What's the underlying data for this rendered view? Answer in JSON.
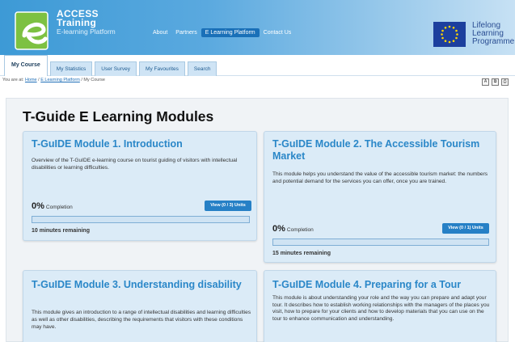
{
  "brand": {
    "line1": "ACCESS",
    "line2": "Training",
    "line3": "E-learning Platform"
  },
  "top_nav": [
    "About",
    "Partners",
    "E Learning Platform",
    "Contact Us"
  ],
  "top_nav_active": "E Learning Platform",
  "eu_programme": [
    "Lifelong",
    "Learning",
    "Programme"
  ],
  "tabs": [
    "My Course",
    "My Statistics",
    "User Survey",
    "My Favourites",
    "Search"
  ],
  "active_tab": "My Course",
  "breadcrumb": {
    "prefix": "You are at:",
    "home": "Home",
    "sep1": "/",
    "platform": "E Learning Platform",
    "sep2": "/",
    "current": "My Course"
  },
  "toolbar_icons": [
    "text-resize-icon",
    "print-preview-icon",
    "print-icon"
  ],
  "page_title": "T-Guide E Learning Modules",
  "completion_label": "Completion",
  "modules": [
    {
      "title": "T-GuIDE Module 1. Introduction",
      "description": "Overview of the T-GuIDE e-learning course on tourist guiding of visitors with intellectual disabilities or learning difficulties.",
      "percent_text": "0%",
      "progress": 0,
      "view_label": "View (0 / 3) Units",
      "remaining": "10 minutes remaining"
    },
    {
      "title": "T-GuIDE Module 2. The Accessible Tourism Market",
      "description": "This module helps you understand the value of the accessible tourism market: the numbers and potential demand for the services you can offer, once you are trained.",
      "percent_text": "0%",
      "progress": 0,
      "view_label": "View (0 / 1) Units",
      "remaining": "15 minutes remaining"
    },
    {
      "title": "T-GuIDE Module 3. Understanding disability",
      "description": "This module gives an introduction to a range of intellectual disabilities and learning difficulties as well as other disabilities, describing the requirements that visitors with these conditions may have."
    },
    {
      "title": "T-GuIDE Module 4. Preparing for a Tour",
      "description": "This module is about understanding your role and the way you can prepare and adapt your tour. It describes how to establish working relationships with the managers of the places you visit, how to prepare for your clients and how to develop materials that you can use on the tour to enhance communication and understanding."
    }
  ],
  "colors": {
    "header_blue": "#3d9ad6",
    "card_bg": "#dbebf7",
    "title_blue": "#2a87c8",
    "button_blue": "#2680c6",
    "eu_blue": "#1c3f9e"
  }
}
